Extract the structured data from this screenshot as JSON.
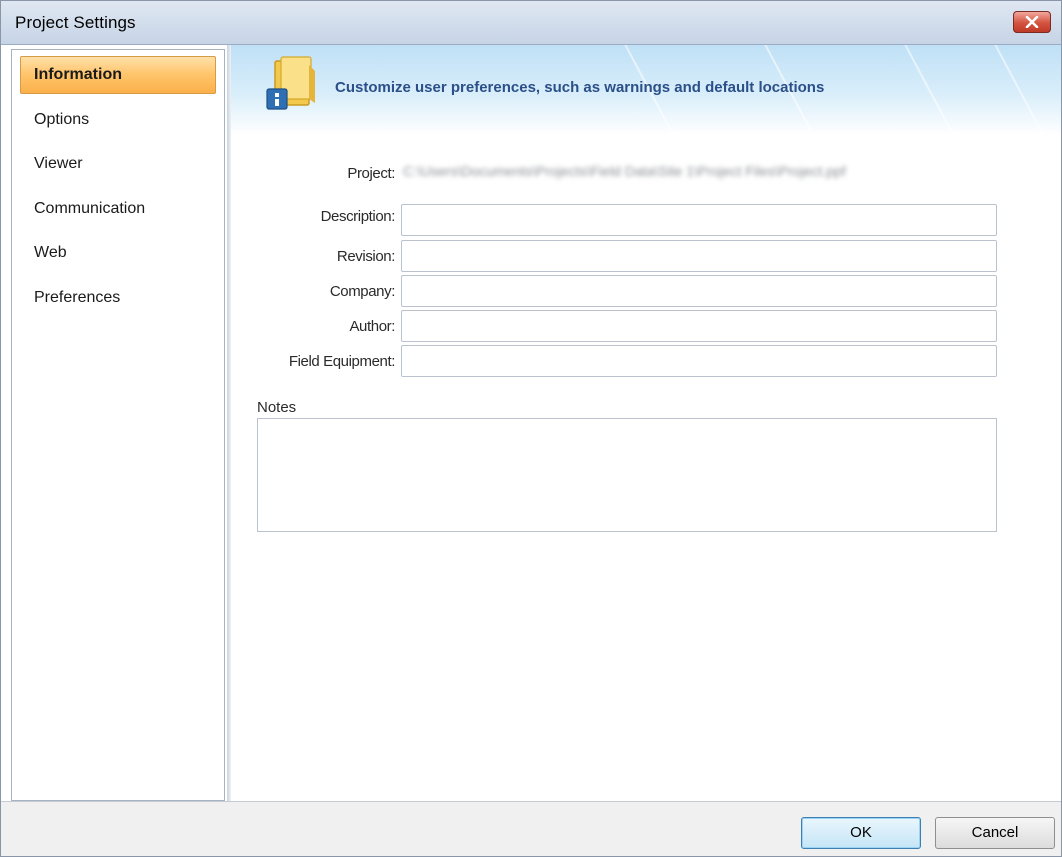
{
  "window": {
    "title": "Project Settings",
    "close_icon": "close-icon"
  },
  "sidebar": {
    "items": [
      {
        "label": "Information",
        "active": true
      },
      {
        "label": "Options",
        "active": false
      },
      {
        "label": "Viewer",
        "active": false
      },
      {
        "label": "Communication",
        "active": false
      },
      {
        "label": "Web",
        "active": false
      },
      {
        "label": "Preferences",
        "active": false
      }
    ]
  },
  "banner": {
    "icon": "folder-info-icon",
    "text": "Customize user preferences, such as warnings and default locations"
  },
  "form": {
    "project_label": "Project:",
    "project_value": "C:\\Users\\Documents\\Projects\\Field Data\\Site 1\\Project Files\\Project.ppf",
    "description_label": "Description:",
    "description_value": "",
    "revision_label": "Revision:",
    "revision_value": "",
    "company_label": "Company:",
    "company_value": "",
    "author_label": "Author:",
    "author_value": "",
    "field_equipment_label": "Field Equipment:",
    "field_equipment_value": "",
    "notes_label": "Notes",
    "notes_value": ""
  },
  "buttons": {
    "ok": "OK",
    "cancel": "Cancel"
  },
  "colors": {
    "active_item": "#ffc46a",
    "banner_text": "#2b4f88",
    "close_button": "#d3533f"
  }
}
